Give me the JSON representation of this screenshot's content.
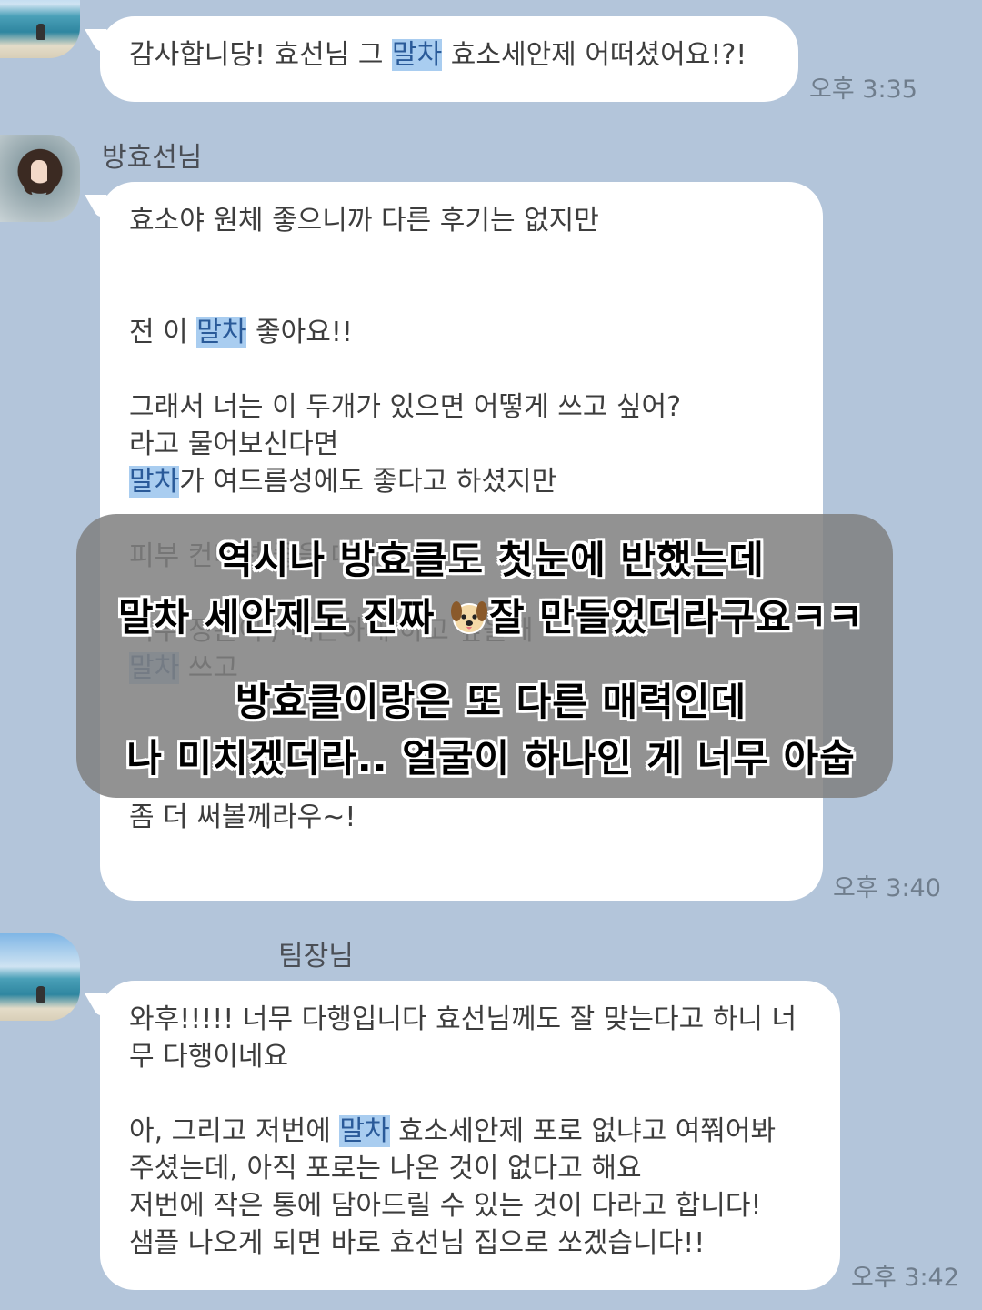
{
  "messages": [
    {
      "lines": [
        [
          {
            "t": "감사합니당! 효선님 그 "
          },
          {
            "t": "말차",
            "hl": true
          },
          {
            "t": " 효소세안제 어떠셨어요!?!"
          }
        ]
      ],
      "time": "오후 3:35"
    },
    {
      "sender": "방효선님",
      "lines": [
        [
          {
            "t": "효소야 원체 좋으니까 다른 후기는 없지만"
          }
        ],
        [
          {
            "t": ""
          }
        ],
        [
          {
            "t": ""
          }
        ],
        [
          {
            "t": "전 이 "
          },
          {
            "t": "말차",
            "hl": true
          },
          {
            "t": " 좋아요!!"
          }
        ],
        [
          {
            "t": ""
          }
        ],
        [
          {
            "t": "그래서 너는 이 두개가 있으면 어떻게 쓰고 싶어?"
          }
        ],
        [
          {
            "t": "라고 물어보신다면"
          }
        ],
        [
          {
            "t": "말차",
            "hl": true
          },
          {
            "t": "가 여드름성에도 좋다고 하셨지만"
          }
        ],
        [
          {
            "t": ""
          }
        ],
        [
          {
            "t": "피부 컨디션 좋을 때"
          },
          {
            "t": "세안"
          }
        ],
        [
          {
            "t": ""
          }
        ],
        [
          {
            "t": "피부 정돈이 / 매끈하게 하고 싶을때"
          }
        ],
        [
          {
            "t": "말차",
            "hl": true
          },
          {
            "t": " 쓰고"
          }
        ],
        [
          {
            "t": ""
          }
        ],
        [
          {
            "t": ""
          }
        ],
        [
          {
            "t": ""
          }
        ],
        [
          {
            "t": "좀 더 써볼께라우~!"
          }
        ]
      ],
      "time": "오후 3:40"
    },
    {
      "sender": "팀장님",
      "lines": [
        [
          {
            "t": "와후!!!!! 너무 다행입니다 효선님께도 잘 맞는다고 하니 너"
          }
        ],
        [
          {
            "t": "무 다행이네요"
          }
        ],
        [
          {
            "t": ""
          }
        ],
        [
          {
            "t": "아, 그리고 저번에 "
          },
          {
            "t": "말차",
            "hl": true
          },
          {
            "t": " 효소세안제 포로 없냐고 여쭤어봐"
          }
        ],
        [
          {
            "t": "주셨는데, 아직 포로는 나온 것이 없다고 해요"
          }
        ],
        [
          {
            "t": "저번에 작은 통에 담아드릴 수 있는 것이 다라고 합니다!"
          }
        ],
        [
          {
            "t": "샘플 나오게 되면 바로 효선님 집으로 쏘겠습니다!!"
          }
        ]
      ],
      "time": "오후 3:42"
    }
  ],
  "overlay": {
    "line1": "역시나 방효클도 첫눈에 반했는데",
    "line2_a": "말차 세안제도 진짜 ",
    "line2_emoji_icon": "dog-face-icon",
    "line2_b": "잘 만들었더라구요ㅋㅋ",
    "line3": "방효클이랑은 또 다른 매력인데",
    "line4": "나 미치겠더라.. 얼굴이 하나인 게 너무 아숩"
  }
}
